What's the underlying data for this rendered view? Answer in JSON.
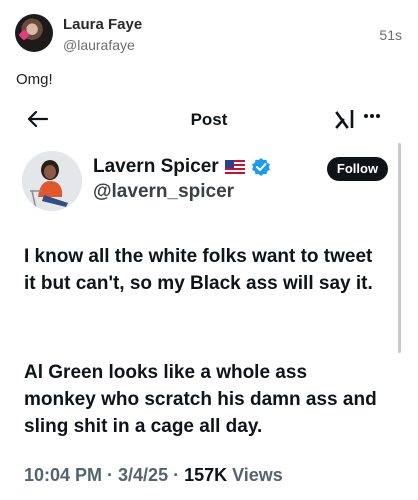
{
  "outer_post": {
    "author_name": "Laura Faye",
    "author_handle": "@laurafaye",
    "time": "51s",
    "text": "Omg!"
  },
  "embedded": {
    "nav": {
      "title": "Post"
    },
    "author": {
      "name": "Lavern Spicer",
      "handle": "@lavern_spicer"
    },
    "follow_label": "Follow",
    "paragraphs": [
      "I know all the white folks want to tweet it but can't, so my Black ass will say it.",
      "Al Green looks like a whole ass monkey who scratch his damn ass and sling shit in a cage all day."
    ],
    "meta": {
      "timestamp": "10:04 PM · 3/4/25 · ",
      "views_count": "157K",
      "views_label": " Views"
    }
  },
  "colors": {
    "text": "#0f1419",
    "secondary": "#536471",
    "verified": "#1d9bf0",
    "follow_bg": "#0f1419"
  }
}
